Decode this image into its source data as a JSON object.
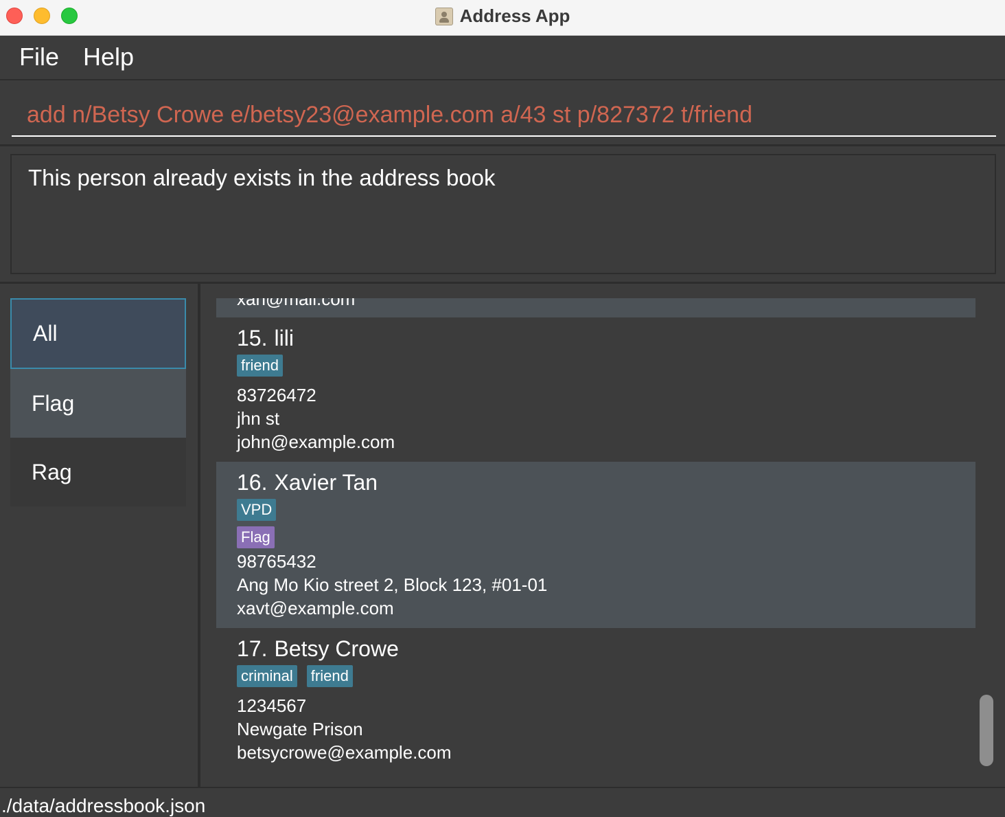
{
  "window": {
    "title": "Address App",
    "icon": "address-book-icon"
  },
  "menu": {
    "file": "File",
    "help": "Help"
  },
  "command": {
    "value": "add n/Betsy Crowe e/betsy23@example.com a/43 st p/827372 t/friend",
    "text_color": "#d06651"
  },
  "result": {
    "message": "This person already exists in the address book"
  },
  "sidebar": {
    "items": [
      {
        "label": "All",
        "selected": true
      },
      {
        "label": "Flag",
        "selected": false
      },
      {
        "label": "Rag",
        "selected": false
      }
    ]
  },
  "persons": {
    "partial_email": "xan@mail.com",
    "items": [
      {
        "index": "15.",
        "name": "lili",
        "tags": [
          "friend"
        ],
        "flags": [],
        "phone": "83726472",
        "address": "jhn st",
        "email": "john@example.com"
      },
      {
        "index": "16.",
        "name": "Xavier Tan",
        "tags": [
          "VPD"
        ],
        "flags": [
          "Flag"
        ],
        "phone": "98765432",
        "address": "Ang Mo Kio street 2, Block 123, #01-01",
        "email": "xavt@example.com"
      },
      {
        "index": "17.",
        "name": "Betsy Crowe",
        "tags": [
          "criminal",
          "friend"
        ],
        "flags": [],
        "phone": "1234567",
        "address": "Newgate Prison",
        "email": "betsycrowe@example.com"
      }
    ]
  },
  "status": {
    "path": "./data/addressbook.json"
  },
  "colors": {
    "tag": "#3e7b91",
    "flag_tag": "#8a6fb5",
    "selected_border": "#3a8bab"
  }
}
